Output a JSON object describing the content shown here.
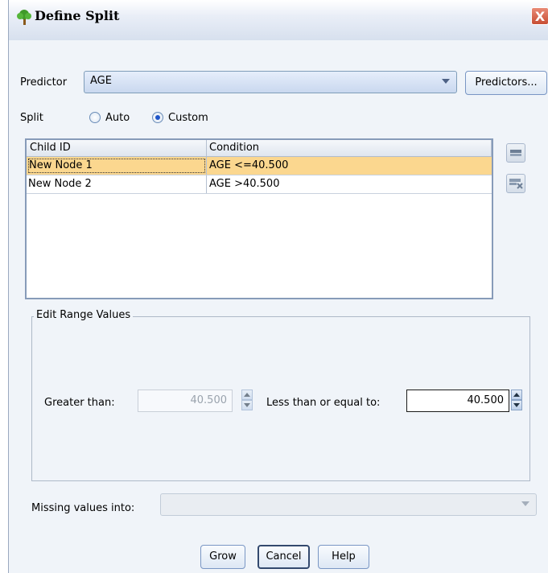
{
  "window": {
    "title": "Define Split",
    "close_label": "X"
  },
  "predictor": {
    "label": "Predictor",
    "value": "AGE",
    "button": "Predictors..."
  },
  "split": {
    "label": "Split",
    "options": [
      "Auto",
      "Custom"
    ],
    "selected": "Custom"
  },
  "table": {
    "columns": [
      "Child ID",
      "Condition"
    ],
    "rows": [
      {
        "child_id": "New Node 1",
        "condition": "AGE <=40.500",
        "selected": true
      },
      {
        "child_id": "New Node 2",
        "condition": "AGE >40.500",
        "selected": false
      }
    ]
  },
  "range": {
    "group_label": "Edit Range Values",
    "greater_label": "Greater than:",
    "greater_value": "40.500",
    "lte_label": "Less than or equal to:",
    "lte_value": "40.500"
  },
  "missing": {
    "label": "Missing values into:",
    "value": ""
  },
  "buttons": {
    "grow": "Grow",
    "cancel": "Cancel",
    "help": "Help"
  },
  "icons": [
    "tree-app-icon",
    "close-icon",
    "dropdown-arrow-icon",
    "add-row-icon",
    "remove-row-icon",
    "spin-up-icon",
    "spin-down-icon"
  ]
}
